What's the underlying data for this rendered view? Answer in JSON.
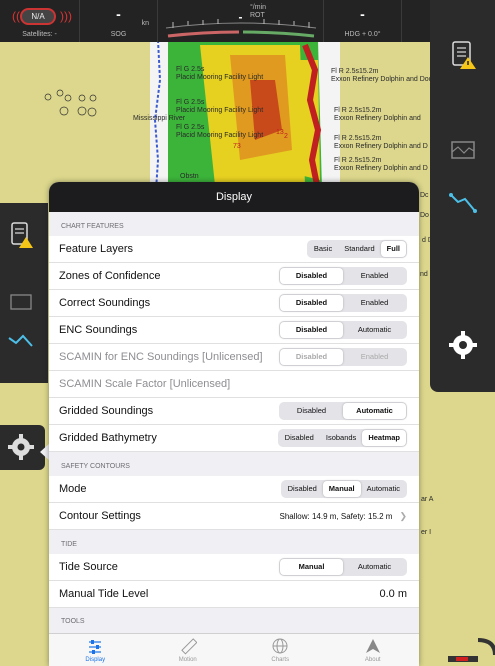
{
  "topbar": {
    "gps_status": "N/A",
    "satellites": "Satellites: -",
    "sog_value": "-",
    "sog_label": "SOG",
    "sog_unit": "kn",
    "rot_value": "-",
    "rot_unit": "°/min",
    "rot_label": "ROT",
    "hdg_value": "-",
    "hdg_label": "HDG + 0.0°"
  },
  "map_labels": [
    "Fl G 2.5s",
    "Placid Mooring Facility Light",
    "Fl G 2.5s",
    "Placid Mooring Facility Light",
    "Fl G 2.5s",
    "Placid Mooring Facility Light",
    "Mississippi River",
    "Fl R 2.5s15.2m",
    "Exxon Refinery Dolphin and Dock",
    "Fl R 2.5s15.2m",
    "Exxon Refinery Dolphin and",
    "Fl R 2.5s15.2m",
    "Exxon Refinery Dolphin and D",
    "Fl R 2.5s15.2m",
    "Exxon Refinery Dolphin and D",
    "13",
    "2",
    "73",
    "Obstn",
    "Dc",
    "Do",
    "d D",
    "nd D",
    "ar A",
    "er I"
  ],
  "popover": {
    "title": "Display",
    "sections": {
      "chart_features": "CHART FEATURES",
      "safety_contours": "SAFETY CONTOURS",
      "tide": "TIDE",
      "tools": "TOOLS"
    },
    "rows": {
      "feature_layers": {
        "label": "Feature Layers",
        "options": [
          "Basic",
          "Standard",
          "Full"
        ],
        "selected": "Full"
      },
      "zones_of_confidence": {
        "label": "Zones of Confidence",
        "options": [
          "Disabled",
          "Enabled"
        ],
        "selected": "Disabled"
      },
      "correct_soundings": {
        "label": "Correct Soundings",
        "options": [
          "Disabled",
          "Enabled"
        ],
        "selected": "Disabled"
      },
      "enc_soundings": {
        "label": "ENC Soundings",
        "options": [
          "Disabled",
          "Automatic"
        ],
        "selected": "Disabled"
      },
      "scamin_enc": {
        "label": "SCAMIN for ENC Soundings [Unlicensed]",
        "options": [
          "Disabled",
          "Enabled"
        ],
        "selected": "Disabled"
      },
      "scamin_scale": {
        "label": "SCAMIN Scale Factor [Unlicensed]"
      },
      "gridded_soundings": {
        "label": "Gridded Soundings",
        "options": [
          "Disabled",
          "Automatic"
        ],
        "selected": "Automatic"
      },
      "gridded_bathymetry": {
        "label": "Gridded Bathymetry",
        "options": [
          "Disabled",
          "Isobands",
          "Heatmap"
        ],
        "selected": "Heatmap"
      },
      "mode": {
        "label": "Mode",
        "options": [
          "Disabled",
          "Manual",
          "Automatic"
        ],
        "selected": "Manual"
      },
      "contour_settings": {
        "label": "Contour Settings",
        "value": "Shallow: 14.9 m, Safety: 15.2 m"
      },
      "tide_source": {
        "label": "Tide Source",
        "options": [
          "Manual",
          "Automatic"
        ],
        "selected": "Manual"
      },
      "manual_tide_level": {
        "label": "Manual Tide Level",
        "value": "0.0  m"
      }
    }
  },
  "tabbar": {
    "tabs": [
      {
        "label": "Display",
        "icon": "sliders-icon",
        "active": true
      },
      {
        "label": "Motion",
        "icon": "ruler-icon",
        "active": false
      },
      {
        "label": "Charts",
        "icon": "globe-icon",
        "active": false
      },
      {
        "label": "About",
        "icon": "triangle-icon",
        "active": false
      }
    ]
  },
  "colors": {
    "accent": "#1a73e8",
    "warning": "#f5c518",
    "panel_dark": "#2b2b2b",
    "land": "#dcd78c"
  }
}
